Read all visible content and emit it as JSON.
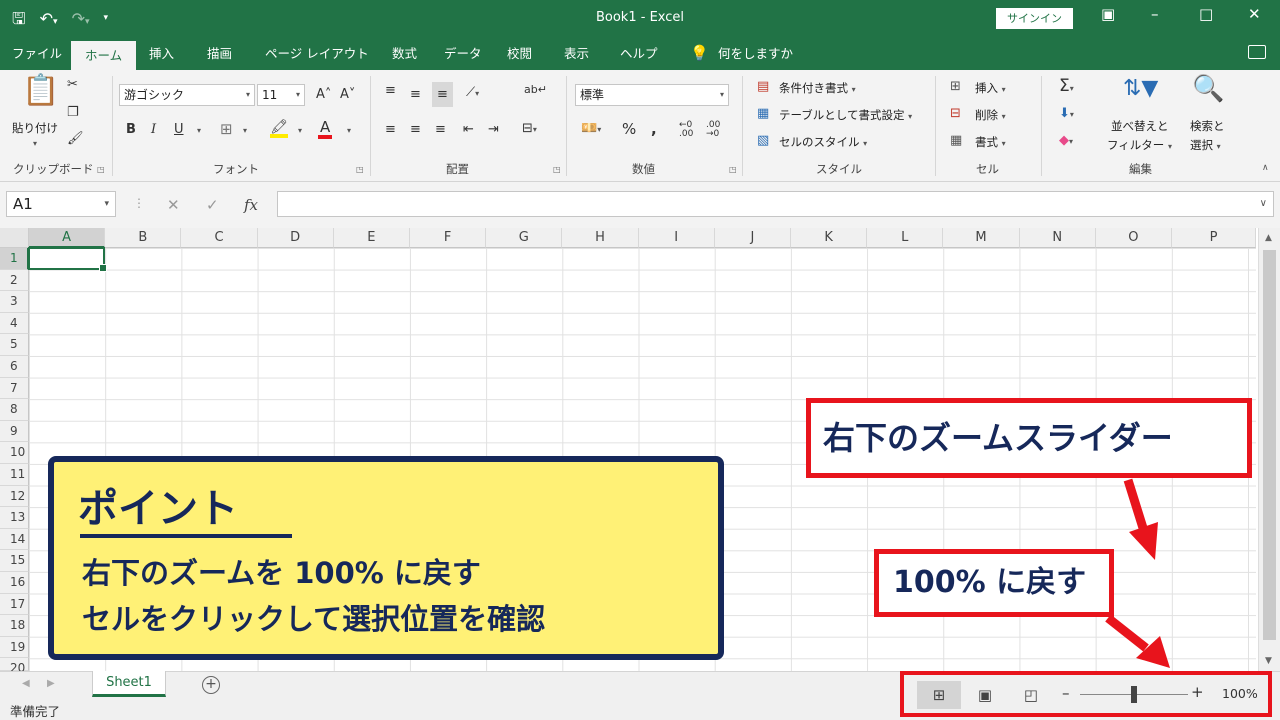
{
  "app": {
    "doc_title": "Book1  -  Excel",
    "signin_label": "サインイン"
  },
  "tabs": [
    {
      "label": "ファイル"
    },
    {
      "label": "ホーム"
    },
    {
      "label": "挿入"
    },
    {
      "label": "描画"
    },
    {
      "label": "ページ レイアウト"
    },
    {
      "label": "数式"
    },
    {
      "label": "データ"
    },
    {
      "label": "校閲"
    },
    {
      "label": "表示"
    },
    {
      "label": "ヘルプ"
    },
    {
      "label": "何をしますか"
    }
  ],
  "ribbon": {
    "clipboard": {
      "label": "クリップボード",
      "paste_label": "貼り付け"
    },
    "font": {
      "label": "フォント",
      "font_name": "游ゴシック",
      "font_size": "11"
    },
    "alignment": {
      "label": "配置"
    },
    "number": {
      "label": "数値",
      "format": "標準"
    },
    "styles": {
      "label": "スタイル",
      "conditional": "条件付き書式",
      "as_table": "テーブルとして書式設定",
      "cell_styles": "セルのスタイル"
    },
    "cells": {
      "label": "セル",
      "insert": "挿入",
      "delete": "削除",
      "format": "書式"
    },
    "editing": {
      "label": "編集",
      "sort_line1": "並べ替えと",
      "sort_line2": "フィルター",
      "find_line1": "検索と",
      "find_line2": "選択"
    }
  },
  "formula_bar": {
    "name_box": "A1",
    "fx": "fx",
    "value": ""
  },
  "grid": {
    "columns": [
      "A",
      "B",
      "C",
      "D",
      "E",
      "F",
      "G",
      "H",
      "I",
      "J",
      "K",
      "L",
      "M",
      "N",
      "O",
      "P"
    ],
    "rows": [
      "1",
      "2",
      "3",
      "4",
      "5",
      "6",
      "7",
      "8",
      "9",
      "10",
      "11",
      "12",
      "13",
      "14",
      "15",
      "16",
      "17",
      "18",
      "19",
      "20"
    ],
    "active_cell": "A1"
  },
  "sheets": [
    {
      "name": "Sheet1"
    }
  ],
  "add_sheet": "+",
  "status": {
    "text": "準備完了",
    "zoom": "100%",
    "zoom_level": 1.0
  },
  "callouts": {
    "point_title": "ポイント",
    "point_line1": "右下のズームを 100% に戻す",
    "point_line2": "セルをクリックして選択位置を確認",
    "zoom_slider_label": "右下のズームスライダー",
    "reset_label": "100% に戻す"
  },
  "colors": {
    "accent": "#217346",
    "callout_red": "#e8141c",
    "callout_navy": "#16285a",
    "callout_yellow": "#fff176"
  }
}
